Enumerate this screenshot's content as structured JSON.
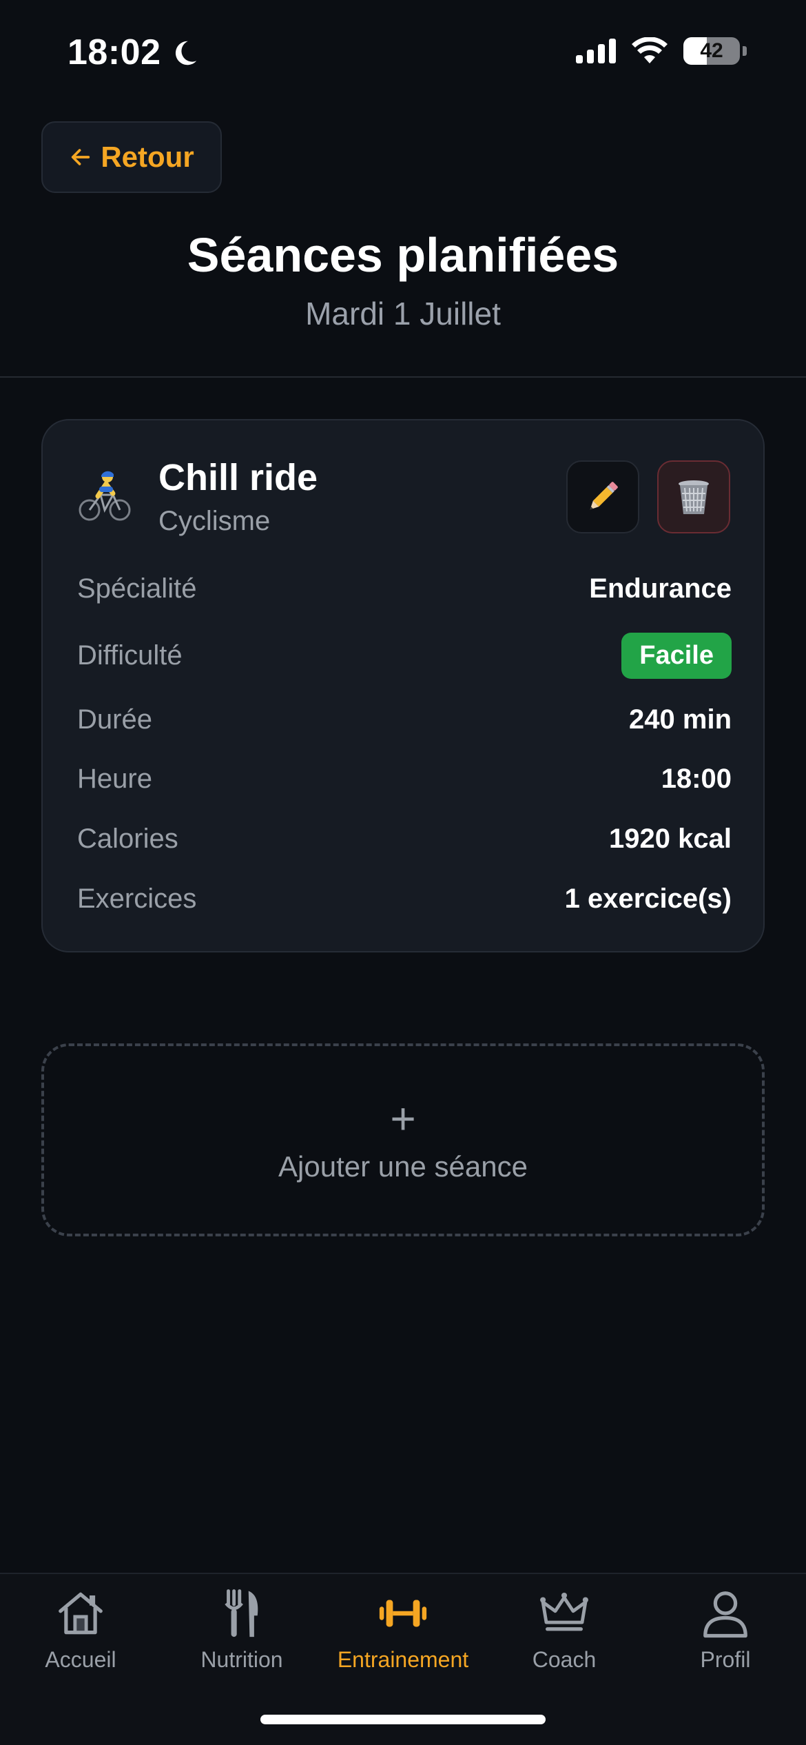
{
  "status_bar": {
    "time": "18:02",
    "battery": "42"
  },
  "header": {
    "back_label": "Retour",
    "title": "Séances planifiées",
    "subtitle": "Mardi 1 Juillet"
  },
  "session": {
    "name": "Chill ride",
    "sport": "Cyclisme",
    "details": [
      {
        "label": "Spécialité",
        "value": "Endurance"
      },
      {
        "label": "Difficulté",
        "value": "Facile"
      },
      {
        "label": "Durée",
        "value": "240 min"
      },
      {
        "label": "Heure",
        "value": "18:00"
      },
      {
        "label": "Calories",
        "value": "1920 kcal"
      },
      {
        "label": "Exercices",
        "value": "1 exercice(s)"
      }
    ]
  },
  "add_session": {
    "plus": "+",
    "label": "Ajouter une séance"
  },
  "nav": {
    "items": [
      {
        "label": "Accueil",
        "icon": "home-icon"
      },
      {
        "label": "Nutrition",
        "icon": "fork-knife-icon"
      },
      {
        "label": "Entrainement",
        "icon": "dumbbell-icon",
        "active": true
      },
      {
        "label": "Coach",
        "icon": "crown-icon"
      },
      {
        "label": "Profil",
        "icon": "user-icon"
      }
    ]
  },
  "colors": {
    "accent": "#f5a623",
    "badge_easy": "#22a447",
    "background": "#0b0e13",
    "card": "#161b23"
  }
}
